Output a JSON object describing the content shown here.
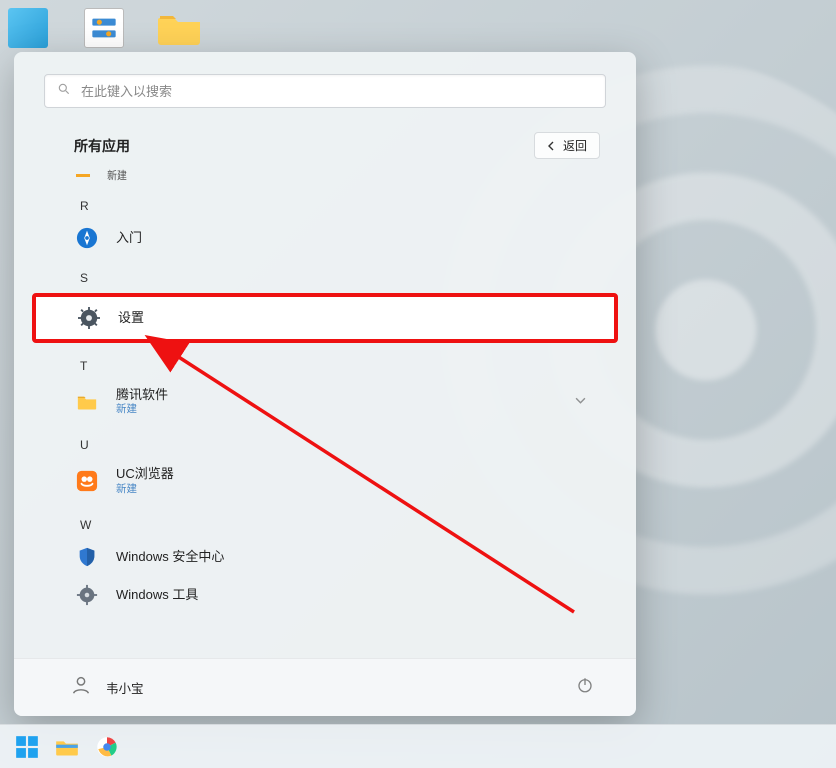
{
  "search": {
    "placeholder": "在此键入以搜索"
  },
  "header": {
    "title": "所有应用",
    "back": "返回"
  },
  "preR": {
    "new_label": "新建"
  },
  "sections": {
    "R": {
      "letter": "R",
      "items": [
        {
          "id": "rumen",
          "label": "入门",
          "sub": "",
          "icon": "compass"
        }
      ]
    },
    "S": {
      "letter": "S",
      "items": [
        {
          "id": "settings",
          "label": "设置",
          "sub": "",
          "icon": "gear",
          "highlight": true
        }
      ]
    },
    "T": {
      "letter": "T",
      "items": [
        {
          "id": "tencent",
          "label": "腾讯软件",
          "sub": "新建",
          "icon": "folder",
          "expandable": true
        }
      ]
    },
    "U": {
      "letter": "U",
      "items": [
        {
          "id": "ucbrowser",
          "label": "UC浏览器",
          "sub": "新建",
          "icon": "uc"
        }
      ]
    },
    "W": {
      "letter": "W",
      "items": [
        {
          "id": "defender",
          "label": "Windows 安全中心",
          "sub": "",
          "icon": "shield"
        },
        {
          "id": "wintools",
          "label": "Windows 工具",
          "sub": "",
          "icon": "toolsgear"
        }
      ]
    }
  },
  "user": {
    "name": "韦小宝"
  }
}
